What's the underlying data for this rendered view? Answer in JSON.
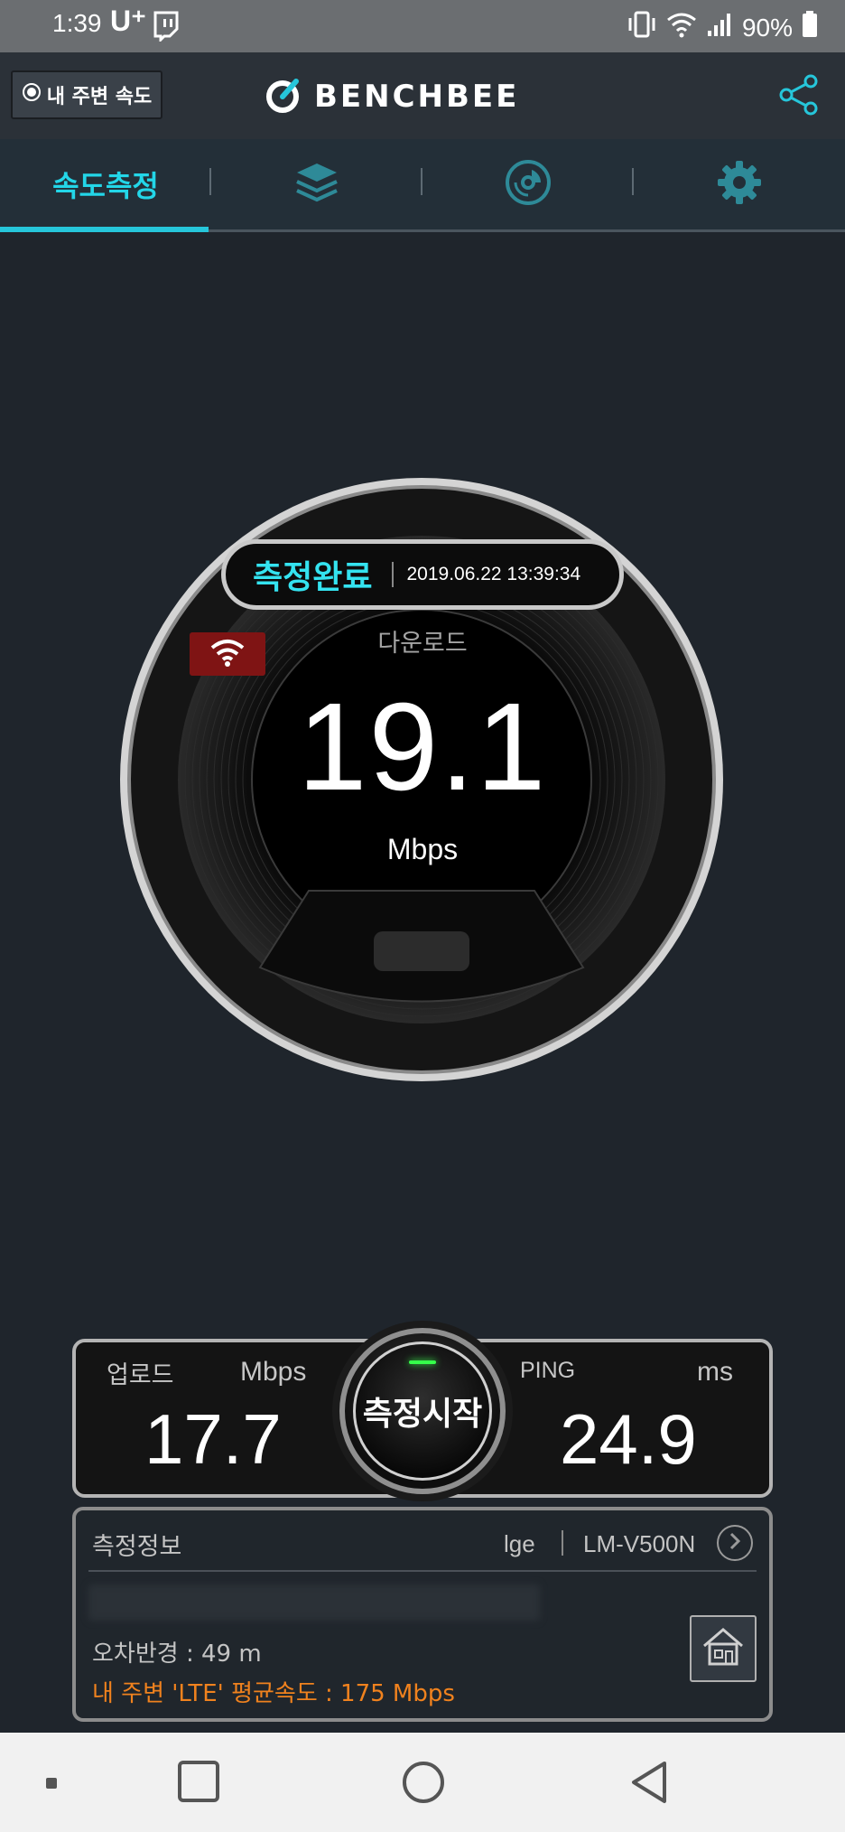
{
  "status_bar": {
    "time": "1:39",
    "carrier": "U⁺",
    "battery": "90%"
  },
  "header": {
    "nearby_button": "내 주변 속도",
    "logo_text": "BENCHBEE"
  },
  "tabs": [
    {
      "label": "속도측정",
      "icon": null,
      "active": true
    },
    {
      "label": "",
      "icon": "layers-icon",
      "active": false
    },
    {
      "label": "",
      "icon": "disk-icon",
      "active": false
    },
    {
      "label": "",
      "icon": "gear-icon",
      "active": false
    }
  ],
  "gauge": {
    "status": "측정완료",
    "datetime": "2019.06.22 13:39:34",
    "download_label": "다운로드",
    "download_value": "19.1",
    "download_unit": "Mbps",
    "connection_icon": "wifi-icon"
  },
  "results": {
    "upload_label": "업로드",
    "upload_unit": "Mbps",
    "upload_value": "17.7",
    "ping_label": "PING",
    "ping_unit": "ms",
    "ping_value": "24.9",
    "start_button": "측정시작"
  },
  "info": {
    "title": "측정정보",
    "vendor": "lge",
    "model": "LM-V500N",
    "error_radius": "오차반경 : 49 m",
    "avg_speed": "내 주변 'LTE' 평균속도 :  175 Mbps"
  },
  "colors": {
    "accent": "#26c6da",
    "background": "#1f252c",
    "avg_text": "#f0821e",
    "wifi_badge": "#7f1414"
  }
}
